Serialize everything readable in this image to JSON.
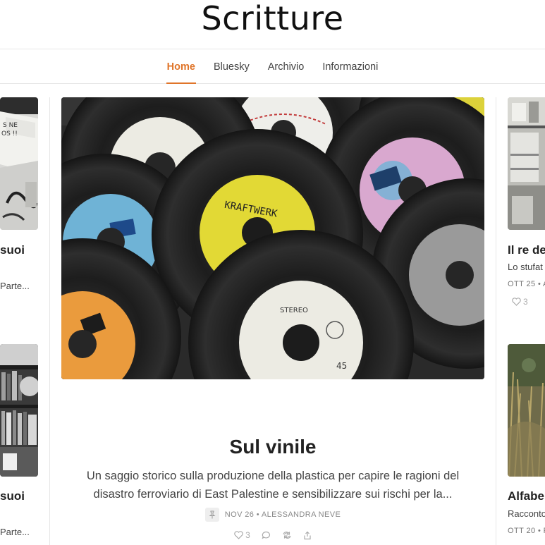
{
  "site": {
    "title": "Scritture"
  },
  "nav": {
    "items": [
      {
        "label": "Home",
        "active": true
      },
      {
        "label": "Bluesky",
        "active": false
      },
      {
        "label": "Archivio",
        "active": false
      },
      {
        "label": "Informazioni",
        "active": false
      }
    ]
  },
  "left_cards": [
    {
      "title": "suoi",
      "subtitle": "Parte..."
    },
    {
      "title": "suoi",
      "subtitle": "Parte..."
    }
  ],
  "feature": {
    "title": "Sul vinile",
    "subtitle": "Un saggio storico sulla produzione della plastica per capire le ragioni del disastro ferroviario di East Palestine e sensibilizzare sui rischi per la...",
    "meta": "NOV 26 • ALESSANDRA NEVE",
    "likes": "3",
    "image_alt": "vinyl records"
  },
  "right_cards": [
    {
      "title": "Il re de",
      "subtitle": "Lo stufat",
      "meta": "OTT 25 • A",
      "likes": "3"
    },
    {
      "title": "Alfabe",
      "subtitle": "Racconto",
      "meta": "OTT 20 • F"
    }
  ],
  "colors": {
    "accent": "#e0752a",
    "text": "#222222",
    "muted": "#888888",
    "border": "#e6e6e6"
  }
}
